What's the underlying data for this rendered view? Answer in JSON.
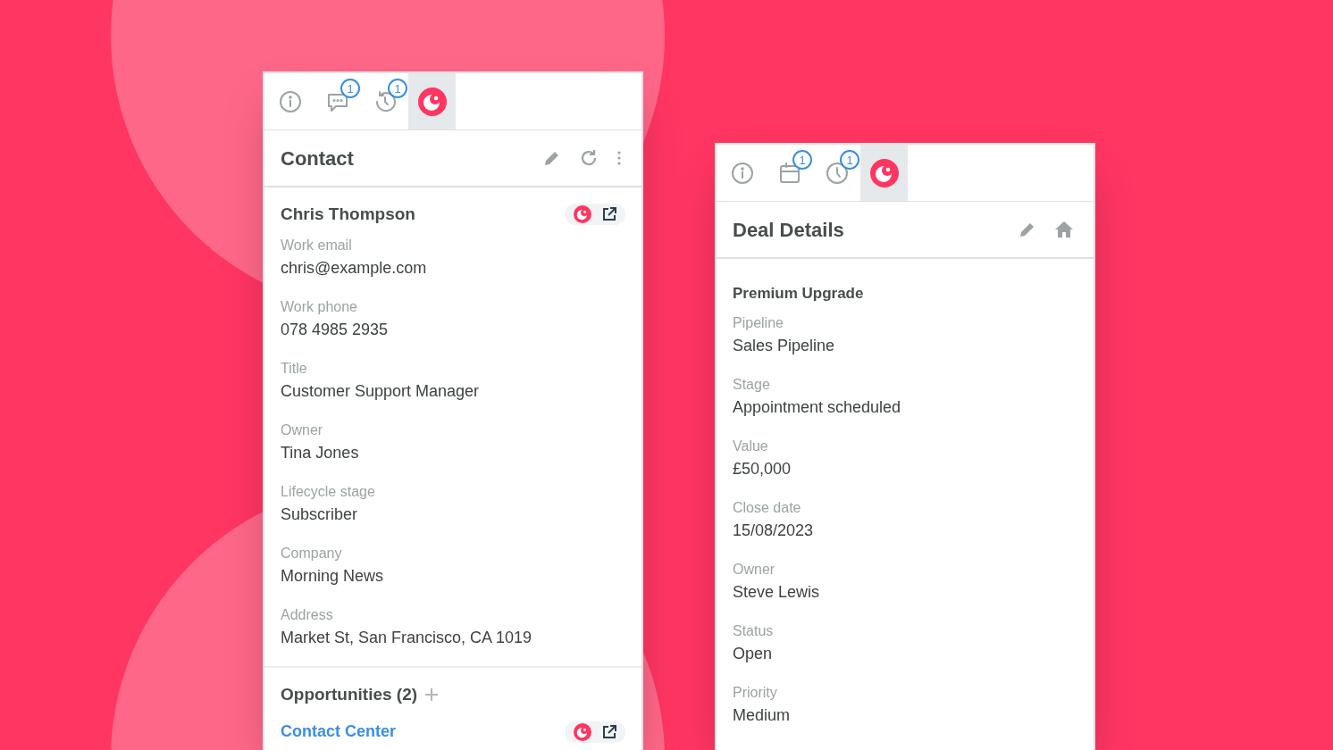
{
  "contact_panel": {
    "tabs": [
      {
        "kind": "info",
        "selected": false
      },
      {
        "kind": "chat",
        "badge": "1",
        "selected": false
      },
      {
        "kind": "history",
        "badge": "1",
        "selected": false
      },
      {
        "kind": "brand",
        "selected": true
      }
    ],
    "header": {
      "title": "Contact",
      "actions": [
        {
          "kind": "edit"
        },
        {
          "kind": "refresh"
        },
        {
          "kind": "more"
        }
      ]
    },
    "record": {
      "name": "Chris Thompson",
      "fields": [
        {
          "label": "Work email",
          "value": "chris@example.com"
        },
        {
          "label": "Work phone",
          "value": "078 4985 2935"
        },
        {
          "label": "Title",
          "value": "Customer Support Manager"
        },
        {
          "label": "Owner",
          "value": "Tina Jones"
        },
        {
          "label": "Lifecycle stage",
          "value": "Subscriber"
        },
        {
          "label": "Company",
          "value": "Morning News"
        },
        {
          "label": "Address",
          "value": "Market St, San Francisco, CA 1019"
        }
      ]
    },
    "opportunities": {
      "title": "Opportunities (2)",
      "items": [
        "Contact Center"
      ]
    }
  },
  "deal_panel": {
    "tabs": [
      {
        "kind": "info",
        "selected": false
      },
      {
        "kind": "calendar",
        "badge": "1",
        "selected": false
      },
      {
        "kind": "clock",
        "badge": "1",
        "selected": false
      },
      {
        "kind": "brand",
        "selected": true
      }
    ],
    "header": {
      "title": "Deal Details",
      "actions": [
        {
          "kind": "edit"
        },
        {
          "kind": "home"
        }
      ]
    },
    "record": {
      "name": "Premium Upgrade",
      "fields": [
        {
          "label": "Pipeline",
          "value": "Sales Pipeline"
        },
        {
          "label": "Stage",
          "value": "Appointment scheduled"
        },
        {
          "label": "Value",
          "value": "£50,000"
        },
        {
          "label": "Close date",
          "value": "15/08/2023"
        },
        {
          "label": "Owner",
          "value": "Steve Lewis"
        },
        {
          "label": "Status",
          "value": "Open"
        },
        {
          "label": "Priority",
          "value": "Medium"
        }
      ]
    }
  }
}
